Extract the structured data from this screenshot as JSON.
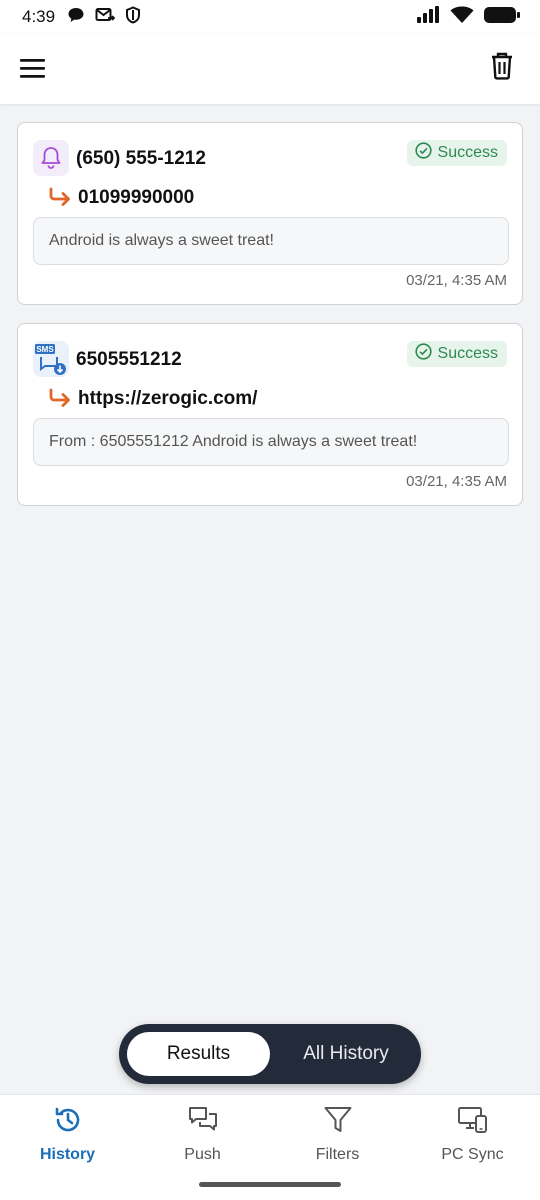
{
  "status_bar": {
    "time": "4:39",
    "left_icons": [
      "chat-bubble-icon",
      "forward-mail-icon",
      "shield-icon"
    ],
    "right_icons": [
      "cell-signal-icon",
      "wifi-icon",
      "battery-icon"
    ]
  },
  "app_bar": {
    "menu_icon": "hamburger-menu-icon",
    "action_icon": "trash-icon"
  },
  "history": [
    {
      "type_icon": "bell-icon",
      "sender": "(650) 555-1212",
      "status": "Success",
      "target": "01099990000",
      "message": "Android is always a sweet treat!",
      "timestamp": "03/21, 4:35 AM"
    },
    {
      "type_icon": "sms-icon",
      "sender": "6505551212",
      "status": "Success",
      "target": "https://zerogic.com/",
      "message": "From : 6505551212 Android is always a sweet treat!",
      "timestamp": "03/21, 4:35 AM"
    }
  ],
  "toggle": {
    "results": "Results",
    "all_history": "All History",
    "selected": "Results"
  },
  "bottom_nav": [
    {
      "label": "History",
      "icon": "history-icon",
      "active": true
    },
    {
      "label": "Push",
      "icon": "push-chat-icon",
      "active": false
    },
    {
      "label": "Filters",
      "icon": "filter-icon",
      "active": false
    },
    {
      "label": "PC Sync",
      "icon": "pc-sync-icon",
      "active": false
    }
  ],
  "colors": {
    "accent": "#1a6fb8",
    "success": "#2d8a4f",
    "success_bg": "#e6f4ec",
    "arrow": "#e0662a",
    "bell": "#a64bd6",
    "toggle_bg": "#232b3a"
  }
}
